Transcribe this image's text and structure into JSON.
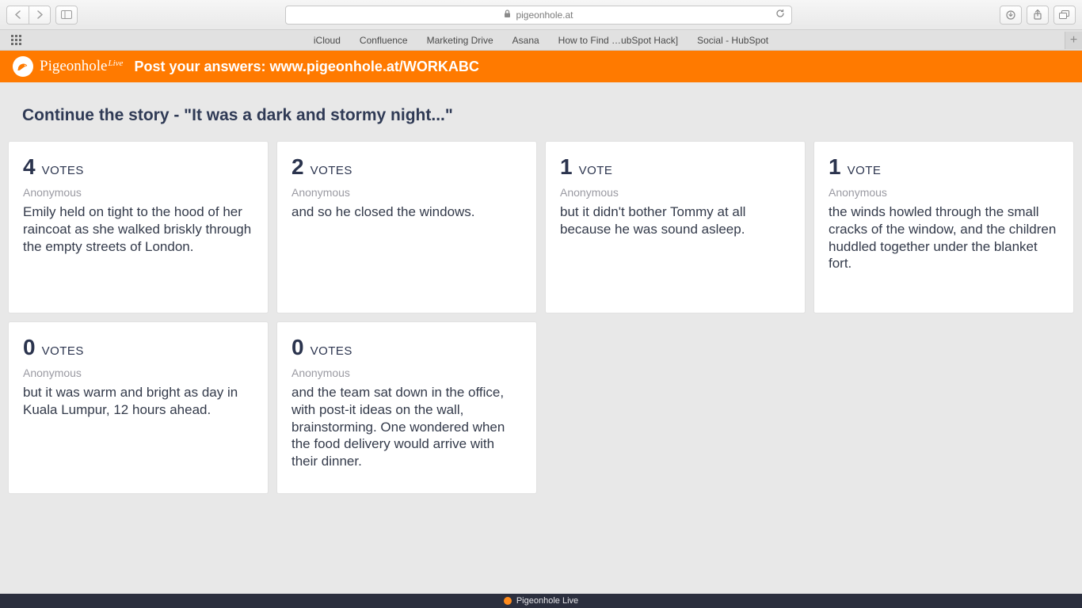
{
  "browser": {
    "url": "pigeonhole.at",
    "bookmarks": [
      "iCloud",
      "Confluence",
      "Marketing Drive",
      "Asana",
      "How to Find …ubSpot Hack]",
      "Social - HubSpot"
    ]
  },
  "header": {
    "brand": "Pigeonhole",
    "brand_sup": "Live",
    "message": "Post your answers: www.pigeonhole.at/WORKABC"
  },
  "question": "Continue the story - \"It was a dark and stormy night...\"",
  "cards": [
    {
      "votes": 4,
      "votes_label": "VOTES",
      "author": "Anonymous",
      "text": "Emily held on tight to the hood of her raincoat as she walked briskly through the empty streets of London."
    },
    {
      "votes": 2,
      "votes_label": "VOTES",
      "author": "Anonymous",
      "text": "and so he closed the windows."
    },
    {
      "votes": 1,
      "votes_label": "VOTE",
      "author": "Anonymous",
      "text": "but it didn't bother Tommy at all because he was sound asleep."
    },
    {
      "votes": 1,
      "votes_label": "VOTE",
      "author": "Anonymous",
      "text": "the winds howled through the small cracks of the window, and the children huddled together under the blanket fort."
    },
    {
      "votes": 0,
      "votes_label": "VOTES",
      "author": "Anonymous",
      "text": "but it was warm and bright as day in Kuala Lumpur, 12 hours ahead."
    },
    {
      "votes": 0,
      "votes_label": "VOTES",
      "author": "Anonymous",
      "text": "and the team sat down in the office, with post-it ideas on the wall, brainstorming. One wondered when the food delivery would arrive with their dinner."
    }
  ],
  "footer": {
    "label": "Pigeonhole Live"
  }
}
